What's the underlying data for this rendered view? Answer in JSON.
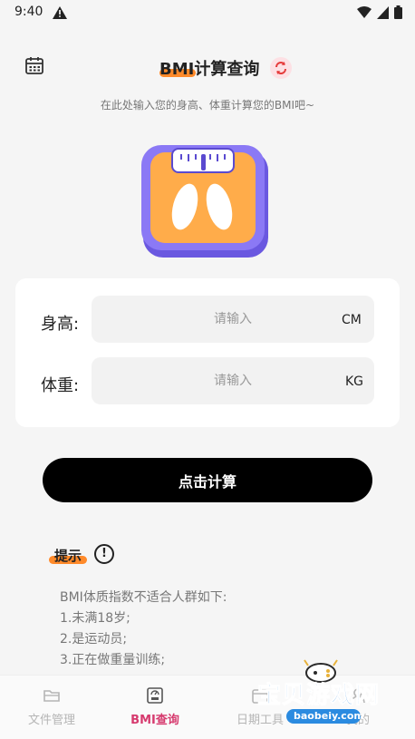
{
  "status_bar": {
    "time": "9:40"
  },
  "header": {
    "title": "BMI计算查询",
    "subtitle": "在此处输入您的身高、体重计算您的BMI吧~"
  },
  "form": {
    "height_label": "身高:",
    "height_placeholder": "请输入",
    "height_unit": "CM",
    "weight_label": "体重:",
    "weight_placeholder": "请输入",
    "weight_unit": "KG"
  },
  "calculate_button": "点击计算",
  "tips": {
    "title": "提示",
    "lines": [
      "BMI体质指数不适合人群如下:",
      "1.未满18岁;",
      "2.是运动员;",
      "3.正在做重量训练;"
    ]
  },
  "bottom_nav": {
    "items": [
      {
        "label": "文件管理",
        "icon": "folder-icon",
        "active": false
      },
      {
        "label": "BMI查询",
        "icon": "bmi-scale-icon",
        "active": true
      },
      {
        "label": "日期工具",
        "icon": "calendar-icon",
        "active": false
      },
      {
        "label": "我的",
        "icon": "profile-icon",
        "active": false
      }
    ]
  },
  "watermark": {
    "title": "宝贝游戏网",
    "url": "baobeiy.com"
  },
  "colors": {
    "accent": "#ff8a2a",
    "nav_active": "#d63a6e",
    "button": "#000000",
    "scale_purple": "#7d6cf2",
    "scale_orange": "#ffac4a"
  }
}
